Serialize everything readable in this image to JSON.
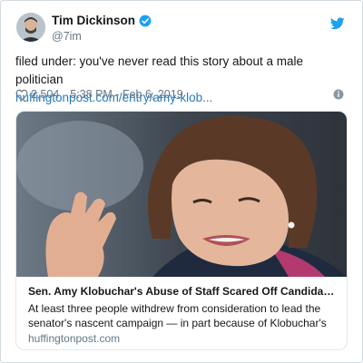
{
  "author": {
    "name": "Tim Dickinson",
    "handle": "@7im",
    "verified": true
  },
  "tweet": {
    "text": "filed under: you've never read this story about a male politician",
    "link_text": "huffingtonpost.com/entry/amy-klob...",
    "likes": "2,504",
    "time": "5:38 PM - Feb 6, 2019"
  },
  "card": {
    "title": "Sen. Amy Klobuchar's Abuse of Staff Scared Off Candidates T...",
    "description": "At least three people withdrew from consideration to lead the senator's nascent campaign — in part because of Klobuchar's",
    "domain": "huffingtonpost.com"
  },
  "icons": {
    "verified": "verified-badge-icon",
    "brand": "twitter-bird-icon",
    "like": "heart-icon",
    "info": "info-icon"
  },
  "colors": {
    "link": "#2b7bb9",
    "verified": "#1da1f2",
    "secondary_text": "#657786"
  }
}
